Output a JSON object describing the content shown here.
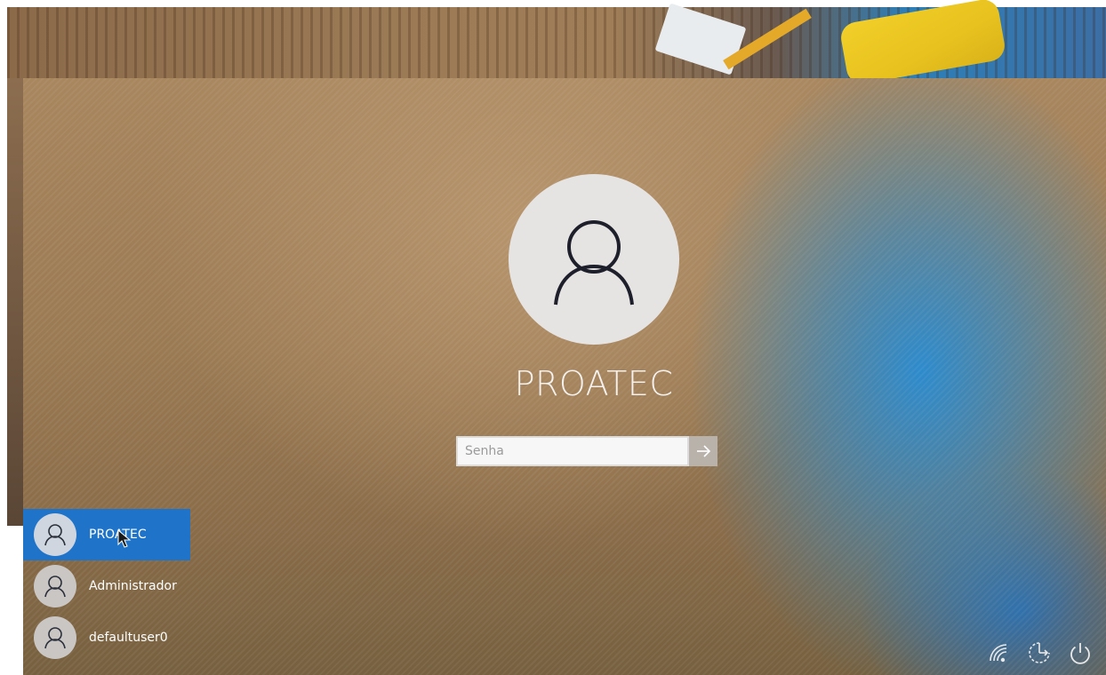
{
  "login": {
    "username": "PROATEC",
    "password_placeholder": "Senha"
  },
  "user_list": [
    {
      "name": "PROATEC",
      "selected": true
    },
    {
      "name": "Administrador",
      "selected": false
    },
    {
      "name": "defaultuser0",
      "selected": false
    }
  ],
  "bottom_icons": [
    "network-icon",
    "ease-of-access-icon",
    "power-icon"
  ],
  "colors": {
    "selected_user_bg": "#1f74c9",
    "avatar_bg": "#e6e3e3"
  }
}
